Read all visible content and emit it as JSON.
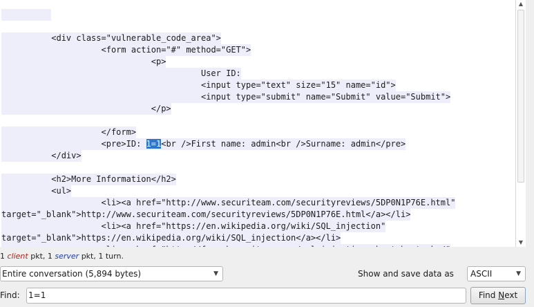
{
  "stream": {
    "lines": [
      {
        "indent": "",
        "text": "          "
      },
      {
        "indent": "",
        "text": ""
      },
      {
        "indent": "          ",
        "text": "<div class=\"vulnerable_code_area\">"
      },
      {
        "indent": "                    ",
        "text": "<form action=\"#\" method=\"GET\">"
      },
      {
        "indent": "                              ",
        "text": "<p>"
      },
      {
        "indent": "                                        ",
        "text": "User ID:"
      },
      {
        "indent": "                                        ",
        "text": "<input type=\"text\" size=\"15\" name=\"id\">"
      },
      {
        "indent": "                                        ",
        "text": "<input type=\"submit\" name=\"Submit\" value=\"Submit\">"
      },
      {
        "indent": "                              ",
        "text": "</p>"
      },
      {
        "indent": "",
        "text": ""
      },
      {
        "indent": "                    ",
        "text": "</form>"
      },
      {
        "indent": "                    ",
        "pre": "<pre>ID: ",
        "match": "1=1",
        "post": "<br />First name: admin<br />Surname: admin</pre>"
      },
      {
        "indent": "          ",
        "text": "</div>"
      },
      {
        "indent": "",
        "text": ""
      },
      {
        "indent": "          ",
        "text": "<h2>More Information</h2>"
      },
      {
        "indent": "          ",
        "text": "<ul>"
      },
      {
        "indent": "                    ",
        "text": "<li><a href=\"http://www.securiteam.com/securityreviews/5DP0N1P76E.html\""
      },
      {
        "indent": "",
        "text": "target=\"_blank\">http://www.securiteam.com/securityreviews/5DP0N1P76E.html</a></li>"
      },
      {
        "indent": "                    ",
        "text": "<li><a href=\"https://en.wikipedia.org/wiki/SQL_injection\""
      },
      {
        "indent": "",
        "text": "target=\"_blank\">https://en.wikipedia.org/wiki/SQL_injection</a></li>"
      },
      {
        "indent": "                    ",
        "text": "<li><a href=\"http://ferruh.mavituna.com/sql-injection-cheatsheet-oku/\""
      }
    ]
  },
  "status": {
    "count_client": "1",
    "client_word": "client",
    "mid1": " pkt, ",
    "count_server": "1",
    "server_word": "server",
    "mid2": " pkt, 1 turn."
  },
  "conversation_select": {
    "value": "Entire conversation (5,894 bytes)"
  },
  "show_save": {
    "label": "Show and save data as",
    "value": "ASCII"
  },
  "find": {
    "label": "Find:",
    "value": "1=1",
    "button_pre": "Find ",
    "button_accel": "N",
    "button_post": "ext"
  },
  "icons": {
    "scroll_up": "▲",
    "scroll_down": "▼",
    "caret": "▼"
  }
}
